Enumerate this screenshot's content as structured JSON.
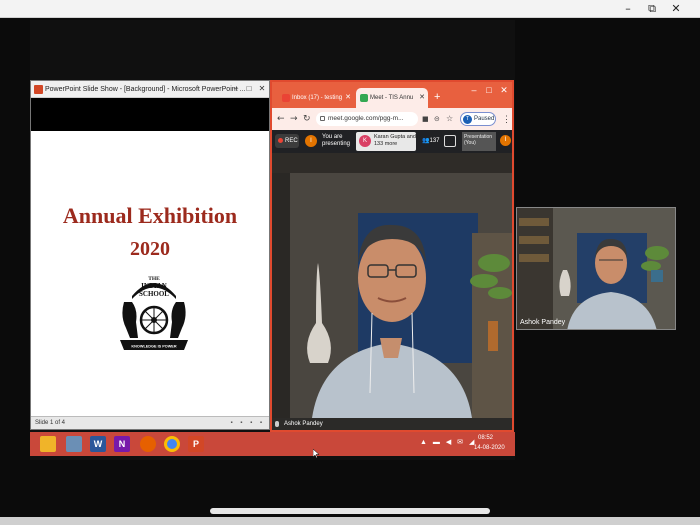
{
  "powerpoint": {
    "window_title": "PowerPoint Slide Show - [Background] - Microsoft PowerPoint ...",
    "slide_title": "Annual Exhibition",
    "slide_year": "2020",
    "logo": {
      "top_text": "THE",
      "middle_text": "INDIAN",
      "bottom_text": "SCHOOL",
      "motto": "KNOWLEDGE IS POWER"
    },
    "status_bar": "Slide 1 of 4"
  },
  "chrome": {
    "tabs": [
      {
        "label": "Inbox (17) - testing",
        "favicon_color": "#ea4335"
      },
      {
        "label": "Meet - TIS Annu",
        "favicon_color": "#34a853"
      }
    ],
    "new_tab": "+",
    "url": "meet.google.com/pgg-m...",
    "profile_button": "Paused",
    "profile_initial": "T"
  },
  "meet": {
    "rec_label": "REC",
    "presenting_avatar": "I",
    "presenting_text": "You are presenting",
    "participant_avatar": "K",
    "participant_text": "Karan Gupta and 133 more",
    "people_count": "137",
    "present_thumb_label": "Presentation (You)",
    "main_video_name": "Ashok Pandey",
    "self_view_name": "Ashok Pandey"
  },
  "taskbar": {
    "time": "08:52",
    "date": "14-08-2020",
    "apps": [
      {
        "name": "file-explorer",
        "glyph": "",
        "color": "#f0b429"
      },
      {
        "name": "notes",
        "glyph": "",
        "color": "#6b8fb5"
      },
      {
        "name": "word",
        "glyph": "W",
        "color": "#2b579a"
      },
      {
        "name": "onenote",
        "glyph": "N",
        "color": "#7719aa"
      },
      {
        "name": "firefox",
        "glyph": "",
        "color": "#e66000"
      },
      {
        "name": "chrome",
        "glyph": "",
        "color": "#4285f4"
      },
      {
        "name": "powerpoint",
        "glyph": "P",
        "color": "#d24726"
      }
    ]
  },
  "colors": {
    "slide_text": "#9c2a1d",
    "chrome_frame": "#e8603f",
    "taskbar": "#c9483a"
  }
}
